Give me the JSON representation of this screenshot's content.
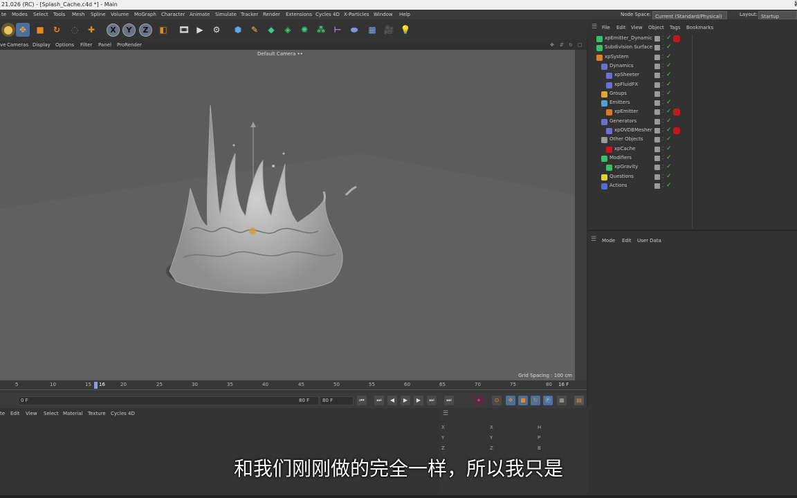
{
  "window": {
    "title": "21.026 (RC) - [Splash_Cache.c4d *] - Main",
    "controls": {
      "minimize": "—",
      "maximize": "☐",
      "close": "✕"
    }
  },
  "menubar": {
    "items": [
      "te",
      "Modes",
      "Select",
      "Tools",
      "Mesh",
      "Spline",
      "Volume",
      "MoGraph",
      "Character",
      "Animate",
      "Simulate",
      "Tracker",
      "Render",
      "Extensions",
      "Cycles 4D",
      "X-Particles",
      "Window",
      "Help"
    ],
    "node_space_label": "Node Space:",
    "node_space_value": "Current (Standard/Physical)",
    "layout_label": "Layout:",
    "layout_value": "Startup"
  },
  "toolbar": {
    "axis_x": "X",
    "axis_y": "Y",
    "axis_z": "Z",
    "icons": [
      "live-selection-icon",
      "move-icon",
      "scale-icon",
      "rotate-icon",
      "last-tool-icon",
      "add-icon",
      "x-axis-icon",
      "y-axis-icon",
      "z-axis-icon",
      "coordinate-system-icon",
      "render-region-icon",
      "render-view-icon",
      "render-settings-icon",
      "cube-icon",
      "pen-icon",
      "subdivision-icon",
      "array-icon",
      "cloner-icon",
      "mograph-icon",
      "deformer-icon",
      "environment-icon",
      "floor-icon",
      "camera-icon",
      "light-icon"
    ]
  },
  "viewport_menu": {
    "items": [
      "ve",
      "Cameras",
      "Display",
      "Options",
      "Filter",
      "Panel",
      "ProRender"
    ],
    "camera_label": "Default Camera ••",
    "grid_spacing": "Grid Spacing : 100 cm"
  },
  "timeline": {
    "ticks": [
      "5",
      "10",
      "15",
      "16",
      "20",
      "25",
      "30",
      "35",
      "40",
      "45",
      "50",
      "55",
      "60",
      "65",
      "70",
      "75",
      "80"
    ],
    "end_label": "16 F"
  },
  "transport": {
    "current_frame": "0 F",
    "max_frame": "80 F",
    "end_frame": "80 F"
  },
  "material_menu": {
    "items": [
      "te",
      "Edit",
      "View",
      "Select",
      "Material",
      "Texture",
      "Cycles 4D"
    ]
  },
  "coords": {
    "labels": [
      "X",
      "Y",
      "Z",
      "X",
      "Y",
      "Z",
      "H",
      "P",
      "B"
    ]
  },
  "object_manager": {
    "menu": [
      "File",
      "Edit",
      "View",
      "Object",
      "Tags",
      "Bookmarks"
    ],
    "objects": [
      {
        "name": "xpEmitter_Dynamic",
        "indent": 0,
        "icon_color": "#3bbf6a",
        "tag": true
      },
      {
        "name": "Subdivision Surface",
        "indent": 0,
        "icon_color": "#3bbf6a",
        "tag": false
      },
      {
        "name": "xpSystem",
        "indent": 0,
        "icon_color": "#d9822b",
        "tag": false
      },
      {
        "name": "Dynamics",
        "indent": 1,
        "icon_color": "#6d6fd0",
        "tag": false
      },
      {
        "name": "xpSheeter",
        "indent": 2,
        "icon_color": "#6d6fd0",
        "tag": false
      },
      {
        "name": "xpFluidFX",
        "indent": 2,
        "icon_color": "#6d6fd0",
        "tag": false
      },
      {
        "name": "Groups",
        "indent": 1,
        "icon_color": "#e0a92a",
        "tag": false
      },
      {
        "name": "Emitters",
        "indent": 1,
        "icon_color": "#4da3d9",
        "tag": false
      },
      {
        "name": "xpEmitter",
        "indent": 2,
        "icon_color": "#d97b2b",
        "tag": true
      },
      {
        "name": "Generators",
        "indent": 1,
        "icon_color": "#6d6fd0",
        "tag": false
      },
      {
        "name": "xpOVDBMesher",
        "indent": 2,
        "icon_color": "#6d6fd0",
        "tag": true
      },
      {
        "name": "Other Objects",
        "indent": 1,
        "icon_color": "#9a9a9a",
        "tag": false
      },
      {
        "name": "xpCache",
        "indent": 2,
        "icon_color": "#c4181f",
        "tag": false
      },
      {
        "name": "Modifiers",
        "indent": 1,
        "icon_color": "#3bbf6a",
        "tag": false
      },
      {
        "name": "xpGravity",
        "indent": 2,
        "icon_color": "#3bbf6a",
        "tag": false
      },
      {
        "name": "Questions",
        "indent": 1,
        "icon_color": "#e0d42a",
        "tag": false
      },
      {
        "name": "Actions",
        "indent": 1,
        "icon_color": "#4d6fd9",
        "tag": false
      }
    ]
  },
  "attribute_manager": {
    "menu": [
      "Mode",
      "Edit",
      "User Data"
    ]
  },
  "subtitle": "和我们刚刚做的完全一样，所以我只是",
  "colors": {
    "accent": "#4d6f9c",
    "viewport": "#5c5c5c",
    "tag_red": "#c4181f",
    "check_green": "#57c94a"
  }
}
